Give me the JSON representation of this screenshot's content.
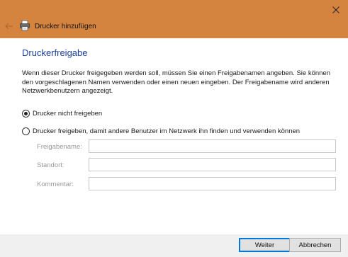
{
  "window": {
    "title": "Drucker hinzufügen",
    "accent": "#d4843f"
  },
  "page": {
    "heading": "Druckerfreigabe",
    "description": "Wenn dieser Drucker freigegeben werden soll, müssen Sie einen Freigabenamen angeben. Sie können den vorgeschlagenen Namen verwenden oder einen neuen eingeben. Der Freigabename wird anderen Netzwerkbenutzern angezeigt."
  },
  "options": {
    "no_share": {
      "label": "Drucker nicht freigeben",
      "checked": true
    },
    "share": {
      "label": "Drucker freigeben, damit andere Benutzer im Netzwerk ihn finden und verwenden können",
      "checked": false
    }
  },
  "fields": {
    "share_name": {
      "label": "Freigabename:",
      "value": ""
    },
    "location": {
      "label": "Standort:",
      "value": ""
    },
    "comment": {
      "label": "Kommentar:",
      "value": ""
    }
  },
  "buttons": {
    "next": "Weiter",
    "cancel": "Abbrechen"
  },
  "icons": {
    "close": "close-icon",
    "back": "back-arrow-icon",
    "printer": "printer-icon"
  }
}
